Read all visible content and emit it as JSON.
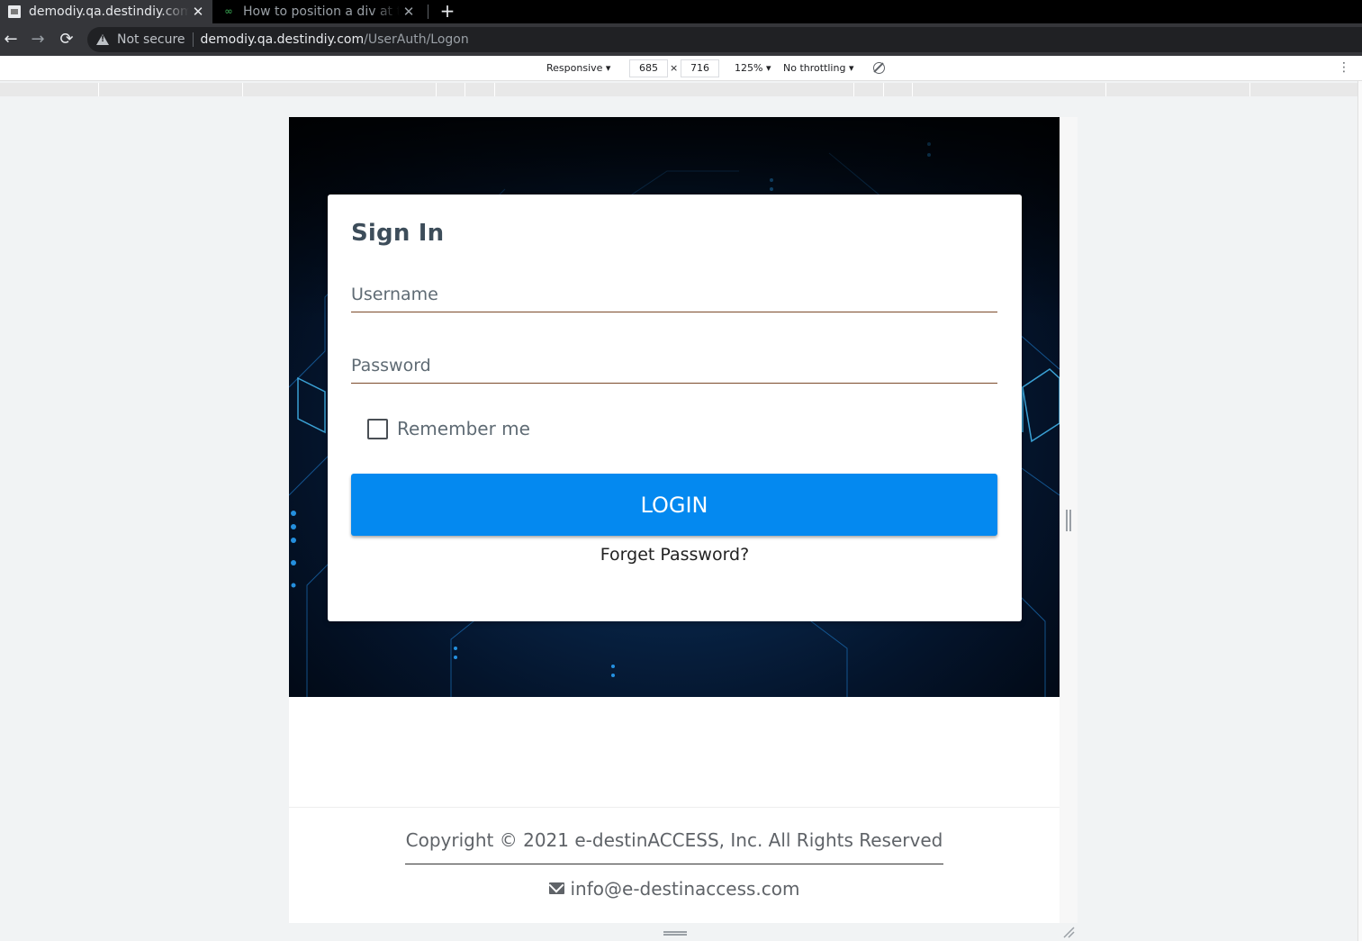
{
  "browser": {
    "tabs": [
      {
        "title": "demodiy.qa.destindiy.com",
        "active": true
      },
      {
        "title": "How to position a div at the",
        "active": false
      }
    ],
    "new_tab_label": "+",
    "close_glyph": "✕",
    "address": {
      "security_label": "Not secure",
      "url_host": "demodiy.qa.destindiy.com",
      "url_path": "/UserAuth/Logon"
    }
  },
  "devtools": {
    "device": "Responsive ▾",
    "width": "685",
    "times": "×",
    "height": "716",
    "zoom": "125% ▾",
    "throttling": "No throttling ▾"
  },
  "page": {
    "signin_title": "Sign In",
    "username_placeholder": "Username",
    "password_placeholder": "Password",
    "remember_label": "Remember me",
    "login_label": "LOGIN",
    "forgot_label": "Forget Password?",
    "copyright": "Copyright © 2021 e-destinACCESS, Inc. All Rights Reserved",
    "email": "info@e-destinaccess.com"
  },
  "colors": {
    "login_button": "#0489f0",
    "hero_dark": "#01060f",
    "hero_glow": "#0d3a6e",
    "title_text": "#3d4d5a"
  }
}
